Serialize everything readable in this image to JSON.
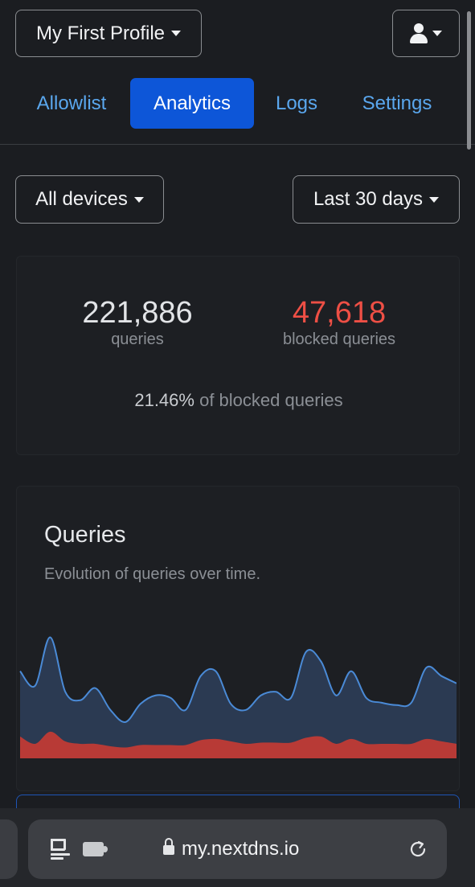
{
  "header": {
    "profile_label": "My First Profile",
    "account_icon": "user-icon"
  },
  "tabs": [
    {
      "label": "Allowlist",
      "active": false
    },
    {
      "label": "Analytics",
      "active": true
    },
    {
      "label": "Logs",
      "active": false
    },
    {
      "label": "Settings",
      "active": false
    }
  ],
  "filters": {
    "devices_label": "All devices",
    "range_label": "Last 30 days"
  },
  "stats": {
    "queries_value": "221,886",
    "queries_label": "queries",
    "blocked_value": "47,618",
    "blocked_label": "blocked queries",
    "ratio_value": "21.46%",
    "ratio_label": "of blocked queries"
  },
  "queries_card": {
    "title": "Queries",
    "subtitle": "Evolution of queries over time."
  },
  "chart_data": {
    "type": "area",
    "x": [
      1,
      2,
      3,
      4,
      5,
      6,
      7,
      8,
      9,
      10,
      11,
      12,
      13,
      14,
      15,
      16,
      17,
      18,
      19,
      20,
      21,
      22,
      23,
      24,
      25,
      26,
      27,
      28,
      29,
      30
    ],
    "series": [
      {
        "values": [
          72,
          60,
          100,
          55,
          48,
          58,
          40,
          30,
          45,
          52,
          50,
          40,
          68,
          72,
          45,
          40,
          52,
          55,
          50,
          88,
          80,
          52,
          72,
          50,
          46,
          44,
          46,
          75,
          68,
          62
        ]
      },
      {
        "values": [
          18,
          12,
          22,
          14,
          12,
          12,
          10,
          9,
          11,
          11,
          11,
          11,
          15,
          16,
          14,
          12,
          13,
          13,
          13,
          17,
          18,
          12,
          16,
          12,
          12,
          12,
          12,
          16,
          14,
          12
        ]
      }
    ],
    "colors": {
      "total": "#4a8ad6",
      "total_fill": "#2b3a52",
      "blocked": "#b83a36",
      "blocked_line": "#e04a45"
    },
    "grid": false,
    "legend": "none"
  },
  "browser": {
    "address": "my.nextdns.io",
    "icons": [
      "reader-icon",
      "extension-icon",
      "lock-icon",
      "reload-icon"
    ]
  }
}
